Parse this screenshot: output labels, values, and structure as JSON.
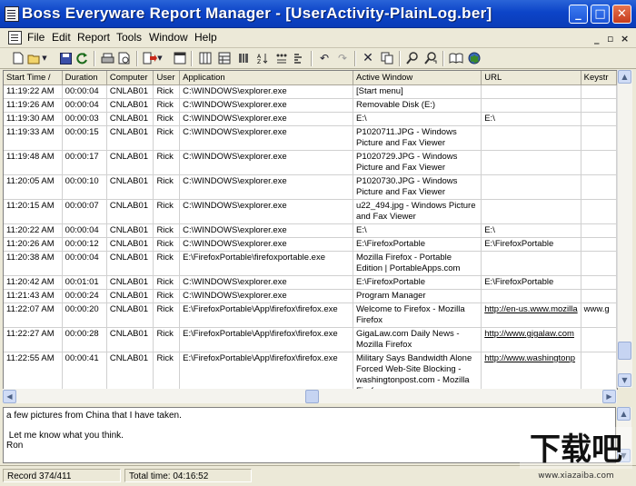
{
  "window": {
    "title": "Boss Everyware Report Manager - [UserActivity-PlainLog.ber]",
    "controls": {
      "minimize": "_",
      "maximize": "□",
      "close": "✕"
    }
  },
  "menu": {
    "items": [
      "File",
      "Edit",
      "Report",
      "Tools",
      "Window",
      "Help"
    ],
    "mdi_controls": [
      "_",
      "▫",
      "×"
    ]
  },
  "toolbar": {
    "icons": [
      "new-icon",
      "open-icon",
      "save-icon",
      "refresh-icon",
      "print-icon",
      "print-preview-icon",
      "export-icon",
      "properties-icon",
      "columns-icon",
      "group-icon",
      "filter-icon",
      "sort-icon",
      "find-column-icon",
      "summary-icon",
      "undo-icon",
      "redo-icon",
      "delete-icon",
      "copy-icon",
      "find-icon",
      "find-next-icon",
      "help-book-icon",
      "web-icon"
    ]
  },
  "grid": {
    "columns": [
      "Start Time /",
      "Duration",
      "Computer",
      "User",
      "Application",
      "Active Window",
      "URL",
      "Keystr"
    ],
    "rows": [
      [
        "11:19:22 AM",
        "00:00:04",
        "CNLAB01",
        "Rick",
        "C:\\WINDOWS\\explorer.exe",
        "[Start menu]",
        ""
      ],
      [
        "11:19:26 AM",
        "00:00:04",
        "CNLAB01",
        "Rick",
        "C:\\WINDOWS\\explorer.exe",
        "Removable Disk (E:)",
        ""
      ],
      [
        "11:19:30 AM",
        "00:00:03",
        "CNLAB01",
        "Rick",
        "C:\\WINDOWS\\explorer.exe",
        "E:\\",
        "E:\\"
      ],
      [
        "11:19:33 AM",
        "00:00:15",
        "CNLAB01",
        "Rick",
        "C:\\WINDOWS\\explorer.exe",
        "P1020711.JPG - Windows Picture and Fax Viewer",
        ""
      ],
      [
        "11:19:48 AM",
        "00:00:17",
        "CNLAB01",
        "Rick",
        "C:\\WINDOWS\\explorer.exe",
        "P1020729.JPG - Windows Picture and Fax Viewer",
        ""
      ],
      [
        "11:20:05 AM",
        "00:00:10",
        "CNLAB01",
        "Rick",
        "C:\\WINDOWS\\explorer.exe",
        "P1020730.JPG - Windows Picture and Fax Viewer",
        ""
      ],
      [
        "11:20:15 AM",
        "00:00:07",
        "CNLAB01",
        "Rick",
        "C:\\WINDOWS\\explorer.exe",
        "u22_494.jpg - Windows Picture and Fax Viewer",
        ""
      ],
      [
        "11:20:22 AM",
        "00:00:04",
        "CNLAB01",
        "Rick",
        "C:\\WINDOWS\\explorer.exe",
        "E:\\",
        "E:\\"
      ],
      [
        "11:20:26 AM",
        "00:00:12",
        "CNLAB01",
        "Rick",
        "C:\\WINDOWS\\explorer.exe",
        "E:\\FirefoxPortable",
        "E:\\FirefoxPortable"
      ],
      [
        "11:20:38 AM",
        "00:00:04",
        "CNLAB01",
        "Rick",
        "E:\\FirefoxPortable\\firefoxportable.exe",
        "Mozilla Firefox - Portable Edition | PortableApps.com",
        ""
      ],
      [
        "11:20:42 AM",
        "00:01:01",
        "CNLAB01",
        "Rick",
        "C:\\WINDOWS\\explorer.exe",
        "E:\\FirefoxPortable",
        "E:\\FirefoxPortable"
      ],
      [
        "11:21:43 AM",
        "00:00:24",
        "CNLAB01",
        "Rick",
        "C:\\WINDOWS\\explorer.exe",
        "Program Manager",
        ""
      ],
      [
        "11:22:07 AM",
        "00:00:20",
        "CNLAB01",
        "Rick",
        "E:\\FirefoxPortable\\App\\firefox\\firefox.exe",
        "Welcome to Firefox - Mozilla Firefox",
        "http://en-us.www.mozilla",
        "www.g"
      ],
      [
        "11:22:27 AM",
        "00:00:28",
        "CNLAB01",
        "Rick",
        "E:\\FirefoxPortable\\App\\firefox\\firefox.exe",
        "GigaLaw.com Daily News - Mozilla Firefox",
        "http://www.gigalaw.com",
        ""
      ],
      [
        "11:22:55 AM",
        "00:00:41",
        "CNLAB01",
        "Rick",
        "E:\\FirefoxPortable\\App\\firefox\\firefox.exe",
        "Military Says Bandwidth Alone Forced Web-Site Blocking - washingtonpost.com - Mozilla Firefox",
        "http://www.washingtonp",
        ""
      ]
    ]
  },
  "notes": {
    "lines": [
      "a few pictures from China that I have taken.",
      "",
      " Let me know what you think.",
      "Ron"
    ]
  },
  "status": {
    "record": "Record 374/411",
    "total_time": "Total time: 04:16:52"
  },
  "watermark": {
    "logo": "下载吧",
    "url": "www.xiazaiba.com"
  }
}
